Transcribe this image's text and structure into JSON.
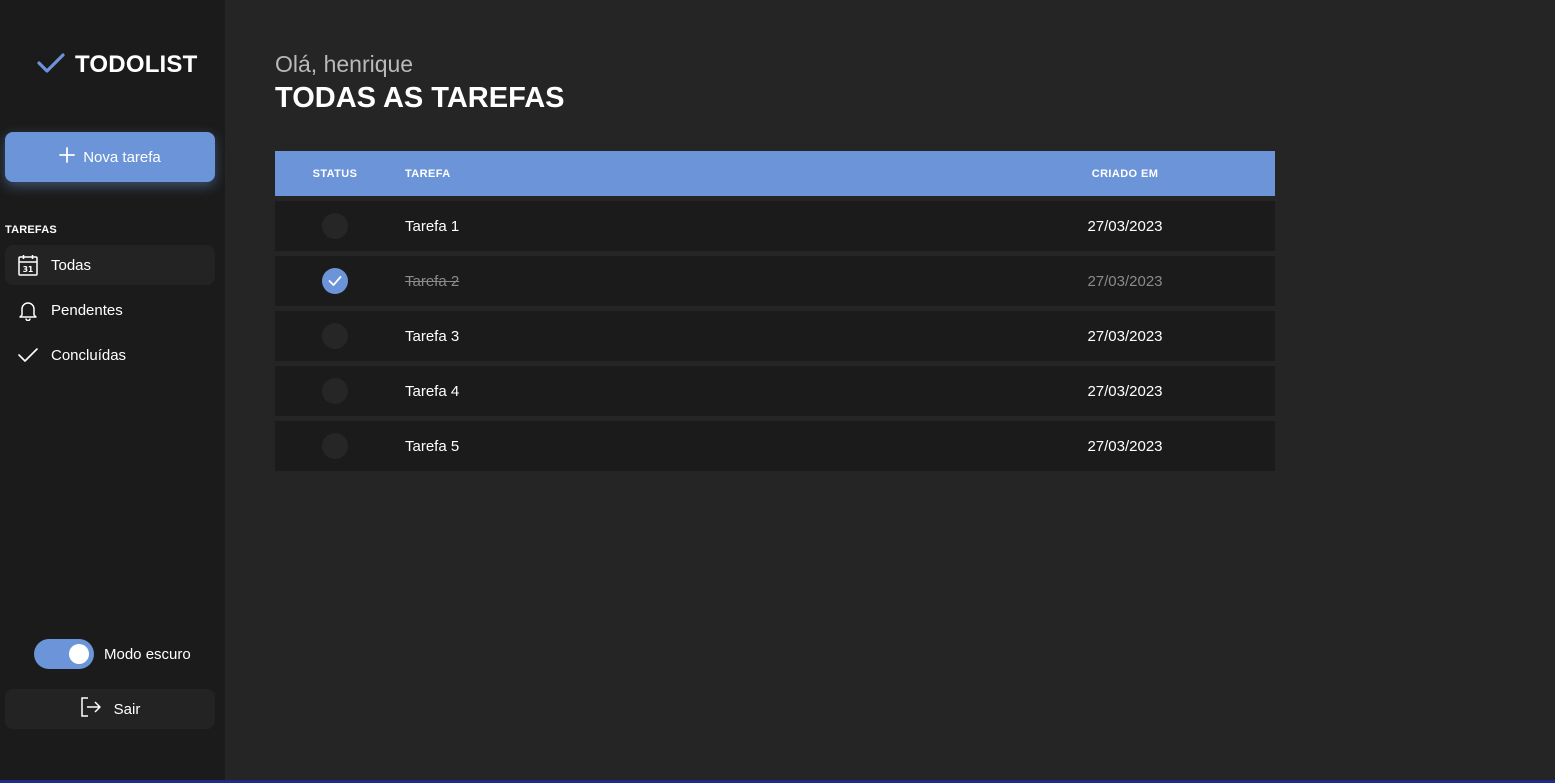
{
  "app": {
    "name": "TODOLIST"
  },
  "sidebar": {
    "new_task_label": "Nova tarefa",
    "section_title": "TAREFAS",
    "items": [
      {
        "label": "Todas",
        "icon": "calendar-icon",
        "active": true
      },
      {
        "label": "Pendentes",
        "icon": "bell-icon",
        "active": false
      },
      {
        "label": "Concluídas",
        "icon": "check-icon",
        "active": false
      }
    ],
    "dark_mode_label": "Modo escuro",
    "dark_mode_on": true,
    "logout_label": "Sair"
  },
  "main": {
    "greeting": "Olá, henrique",
    "title": "TODAS AS TAREFAS",
    "table": {
      "headers": {
        "status": "STATUS",
        "task": "TAREFA",
        "created": "CRIADO EM"
      },
      "rows": [
        {
          "task": "Tarefa 1",
          "created": "27/03/2023",
          "done": false
        },
        {
          "task": "Tarefa 2",
          "created": "27/03/2023",
          "done": true
        },
        {
          "task": "Tarefa 3",
          "created": "27/03/2023",
          "done": false
        },
        {
          "task": "Tarefa 4",
          "created": "27/03/2023",
          "done": false
        },
        {
          "task": "Tarefa 5",
          "created": "27/03/2023",
          "done": false
        }
      ]
    }
  },
  "colors": {
    "accent": "#6b95d8",
    "sidebar_bg": "#1b1b1b",
    "main_bg": "#252525"
  }
}
